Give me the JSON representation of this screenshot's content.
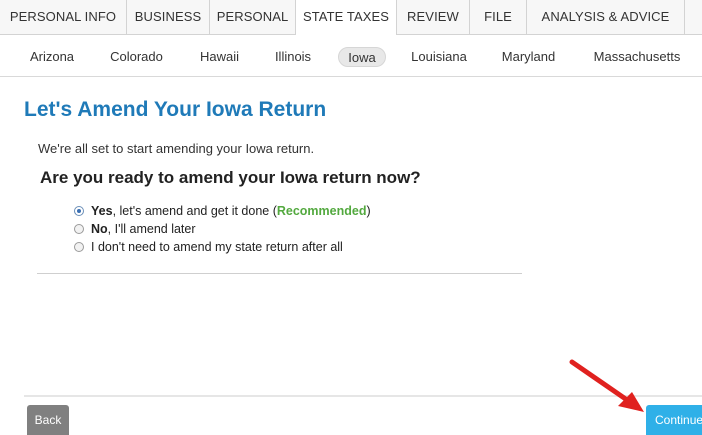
{
  "top_tabs": [
    {
      "label": "PERSONAL INFO"
    },
    {
      "label": "BUSINESS"
    },
    {
      "label": "PERSONAL"
    },
    {
      "label": "STATE TAXES"
    },
    {
      "label": "REVIEW"
    },
    {
      "label": "FILE"
    },
    {
      "label": "ANALYSIS & ADVICE"
    }
  ],
  "active_top_tab": "STATE TAXES",
  "states": [
    "Arizona",
    "Colorado",
    "Hawaii",
    "Illinois",
    "Iowa",
    "Louisiana",
    "Maryland",
    "Massachusetts"
  ],
  "active_state": "Iowa",
  "main": {
    "title": "Let's Amend Your Iowa Return",
    "intro": "We're all set to start amending your Iowa return.",
    "question": "Are you ready to amend your Iowa return now?",
    "options": [
      {
        "bold": "Yes",
        "text": ", let's amend and get it done (",
        "highlight": "Recommended",
        "suffix": ")",
        "checked": true
      },
      {
        "bold": "No",
        "text": ", I'll amend later",
        "checked": false
      },
      {
        "text": "I don't need to amend my state return after all",
        "checked": false
      }
    ]
  },
  "footer": {
    "back_label": "Back",
    "continue_label": "Continue"
  },
  "colors": {
    "title": "#1f7ab8",
    "recommended": "#53a93f",
    "continue_button": "#2fb0e8",
    "back_button": "#808080",
    "annotation_arrow": "#e0211f"
  },
  "annotation": "red-arrow-pointing-to-continue-button"
}
